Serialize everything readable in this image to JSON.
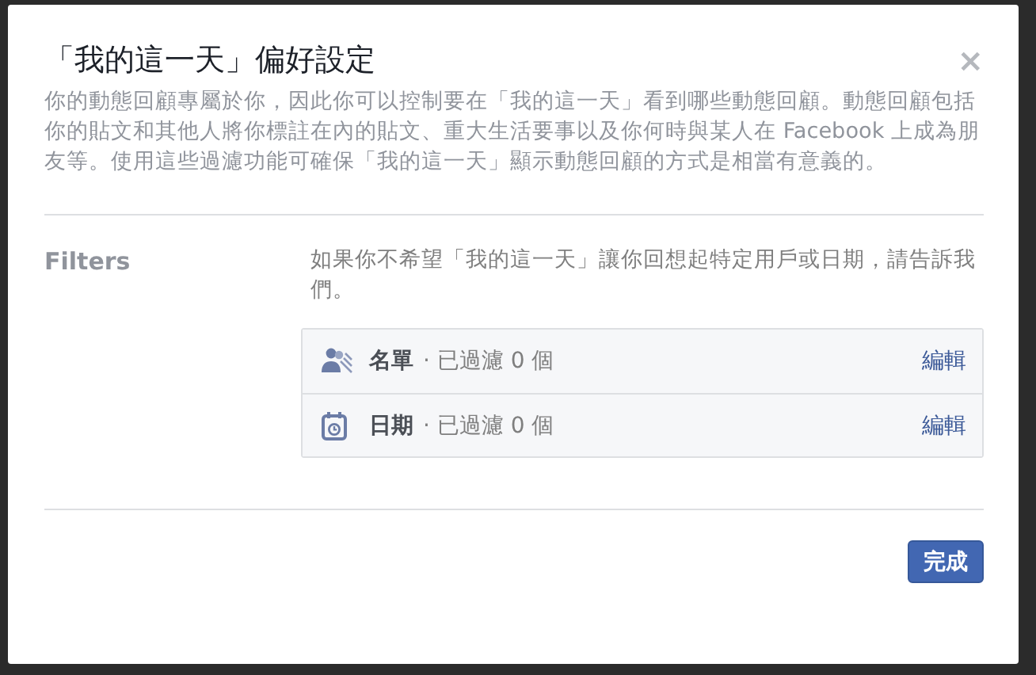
{
  "dialog": {
    "title": "「我的這一天」偏好設定",
    "close": "×",
    "description": "你的動態回顧專屬於你，因此你可以控制要在「我的這一天」看到哪些動態回顧。動態回顧包括你的貼文和其他人將你標註在內的貼文、重大生活要事以及你何時與某人在 Facebook 上成為朋友等。使用這些過濾功能可確保「我的這一天」顯示動態回顧的方式是相當有意義的。"
  },
  "filters_section": {
    "label": "Filters",
    "intro": "如果你不希望「我的這一天」讓你回想起特定用戶或日期，請告訴我們。",
    "filters": [
      {
        "kind": "people",
        "name": "名單",
        "status": "· 已過濾 0 個",
        "action": "編輯"
      },
      {
        "kind": "dates",
        "name": "日期",
        "status": "· 已過濾 0 個",
        "action": "編輯"
      }
    ]
  },
  "buttons": [
    {
      "label": "完成"
    }
  ]
}
